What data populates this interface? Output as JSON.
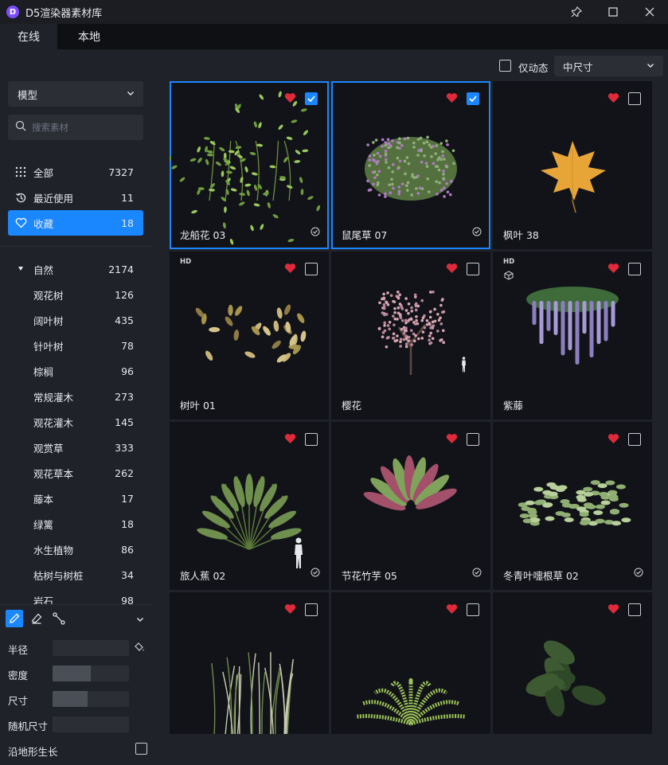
{
  "app": {
    "title": "D5渲染器素材库",
    "logo_letter": "D"
  },
  "window_controls": [
    "pin-icon",
    "maximize-icon",
    "close-icon"
  ],
  "tabs": [
    {
      "label": "在线",
      "active": true
    },
    {
      "label": "本地",
      "active": false
    }
  ],
  "filter": {
    "dynamic_only_label": "仅动态",
    "dynamic_only_checked": false,
    "size_select": "中尺寸"
  },
  "sidebar": {
    "type_select": "模型",
    "search_placeholder": "搜索素材",
    "nav": [
      {
        "label": "全部",
        "count": "7327",
        "icon": "grid-dots-icon",
        "active": false
      },
      {
        "label": "最近使用",
        "count": "11",
        "icon": "history-icon",
        "active": false
      },
      {
        "label": "收藏",
        "count": "18",
        "icon": "heart-outline-icon",
        "active": true
      }
    ],
    "categories": [
      {
        "label": "自然",
        "count": "2174",
        "expanded": true
      },
      {
        "label": "观花树",
        "count": "126"
      },
      {
        "label": "阔叶树",
        "count": "435"
      },
      {
        "label": "针叶树",
        "count": "78"
      },
      {
        "label": "棕榈",
        "count": "96"
      },
      {
        "label": "常规灌木",
        "count": "273"
      },
      {
        "label": "观花灌木",
        "count": "145"
      },
      {
        "label": "观赏草",
        "count": "333"
      },
      {
        "label": "观花草本",
        "count": "262"
      },
      {
        "label": "藤本",
        "count": "17"
      },
      {
        "label": "绿篱",
        "count": "18"
      },
      {
        "label": "水生植物",
        "count": "86"
      },
      {
        "label": "枯树与树桩",
        "count": "34"
      },
      {
        "label": "岩石",
        "count": "98"
      }
    ]
  },
  "brush": {
    "tools": [
      "brush-icon",
      "eraser-icon",
      "path-icon"
    ],
    "params": [
      {
        "label": "半径",
        "level": 0.0
      },
      {
        "label": "密度",
        "level": 0.5
      },
      {
        "label": "尺寸",
        "level": 0.46
      },
      {
        "label": "随机尺寸",
        "level": 0.0
      }
    ],
    "terrain_label": "沿地形生长",
    "terrain_checked": false
  },
  "assets": [
    {
      "name": "龙船花 03",
      "favorited": true,
      "checked": true,
      "selected": true,
      "verified": true,
      "hd": false,
      "anim": false,
      "thumb": "shrub-green-flowers",
      "thumb_color": "#8fbf5a"
    },
    {
      "name": "鼠尾草 07",
      "favorited": true,
      "checked": true,
      "selected": true,
      "verified": true,
      "hd": false,
      "anim": false,
      "thumb": "bush-purple-flowers",
      "thumb_color": "#9c7aa8"
    },
    {
      "name": "枫叶 38",
      "favorited": true,
      "checked": false,
      "selected": false,
      "verified": false,
      "hd": false,
      "anim": false,
      "thumb": "maple-leaf",
      "thumb_color": "#e8a23a"
    },
    {
      "name": "树叶 01",
      "favorited": true,
      "checked": false,
      "selected": false,
      "verified": false,
      "hd": true,
      "hd_label": "HD",
      "anim": false,
      "thumb": "scattered-leaves",
      "thumb_color": "#c9b57a"
    },
    {
      "name": "樱花",
      "favorited": true,
      "checked": false,
      "selected": false,
      "verified": false,
      "hd": false,
      "anim": false,
      "thumb": "cherry-blossom-tree",
      "thumb_color": "#d9a6b3",
      "scale_figure": true
    },
    {
      "name": "紫藤",
      "favorited": true,
      "checked": false,
      "selected": false,
      "verified": false,
      "hd": true,
      "hd_label": "HD",
      "anim": true,
      "thumb": "wisteria",
      "thumb_color": "#a89ad6"
    },
    {
      "name": "旅人蕉 02",
      "favorited": true,
      "checked": false,
      "selected": false,
      "verified": true,
      "hd": false,
      "anim": false,
      "thumb": "travelers-palm",
      "thumb_color": "#6f8f4e",
      "scale_figure": true
    },
    {
      "name": "节花竹芋 05",
      "favorited": true,
      "checked": false,
      "selected": false,
      "verified": true,
      "hd": false,
      "anim": false,
      "thumb": "calathea",
      "thumb_color": "#7fa35a"
    },
    {
      "name": "冬青叶嚏根草 02",
      "favorited": true,
      "checked": false,
      "selected": false,
      "verified": true,
      "hd": false,
      "anim": false,
      "thumb": "hellebore",
      "thumb_color": "#b7cf9a"
    },
    {
      "name": "",
      "favorited": true,
      "checked": false,
      "selected": false,
      "verified": false,
      "hd": false,
      "anim": false,
      "thumb": "ornamental-grass",
      "thumb_color": "#c8cbb0"
    },
    {
      "name": "",
      "favorited": true,
      "checked": false,
      "selected": false,
      "verified": false,
      "hd": false,
      "anim": false,
      "thumb": "fern",
      "thumb_color": "#9cc25a"
    },
    {
      "name": "",
      "favorited": true,
      "checked": false,
      "selected": false,
      "verified": false,
      "hd": false,
      "anim": false,
      "thumb": "large-leaf-plant",
      "thumb_color": "#3d5a32"
    }
  ],
  "colors": {
    "accent": "#1a87ff",
    "heart": "#e02a3a"
  }
}
